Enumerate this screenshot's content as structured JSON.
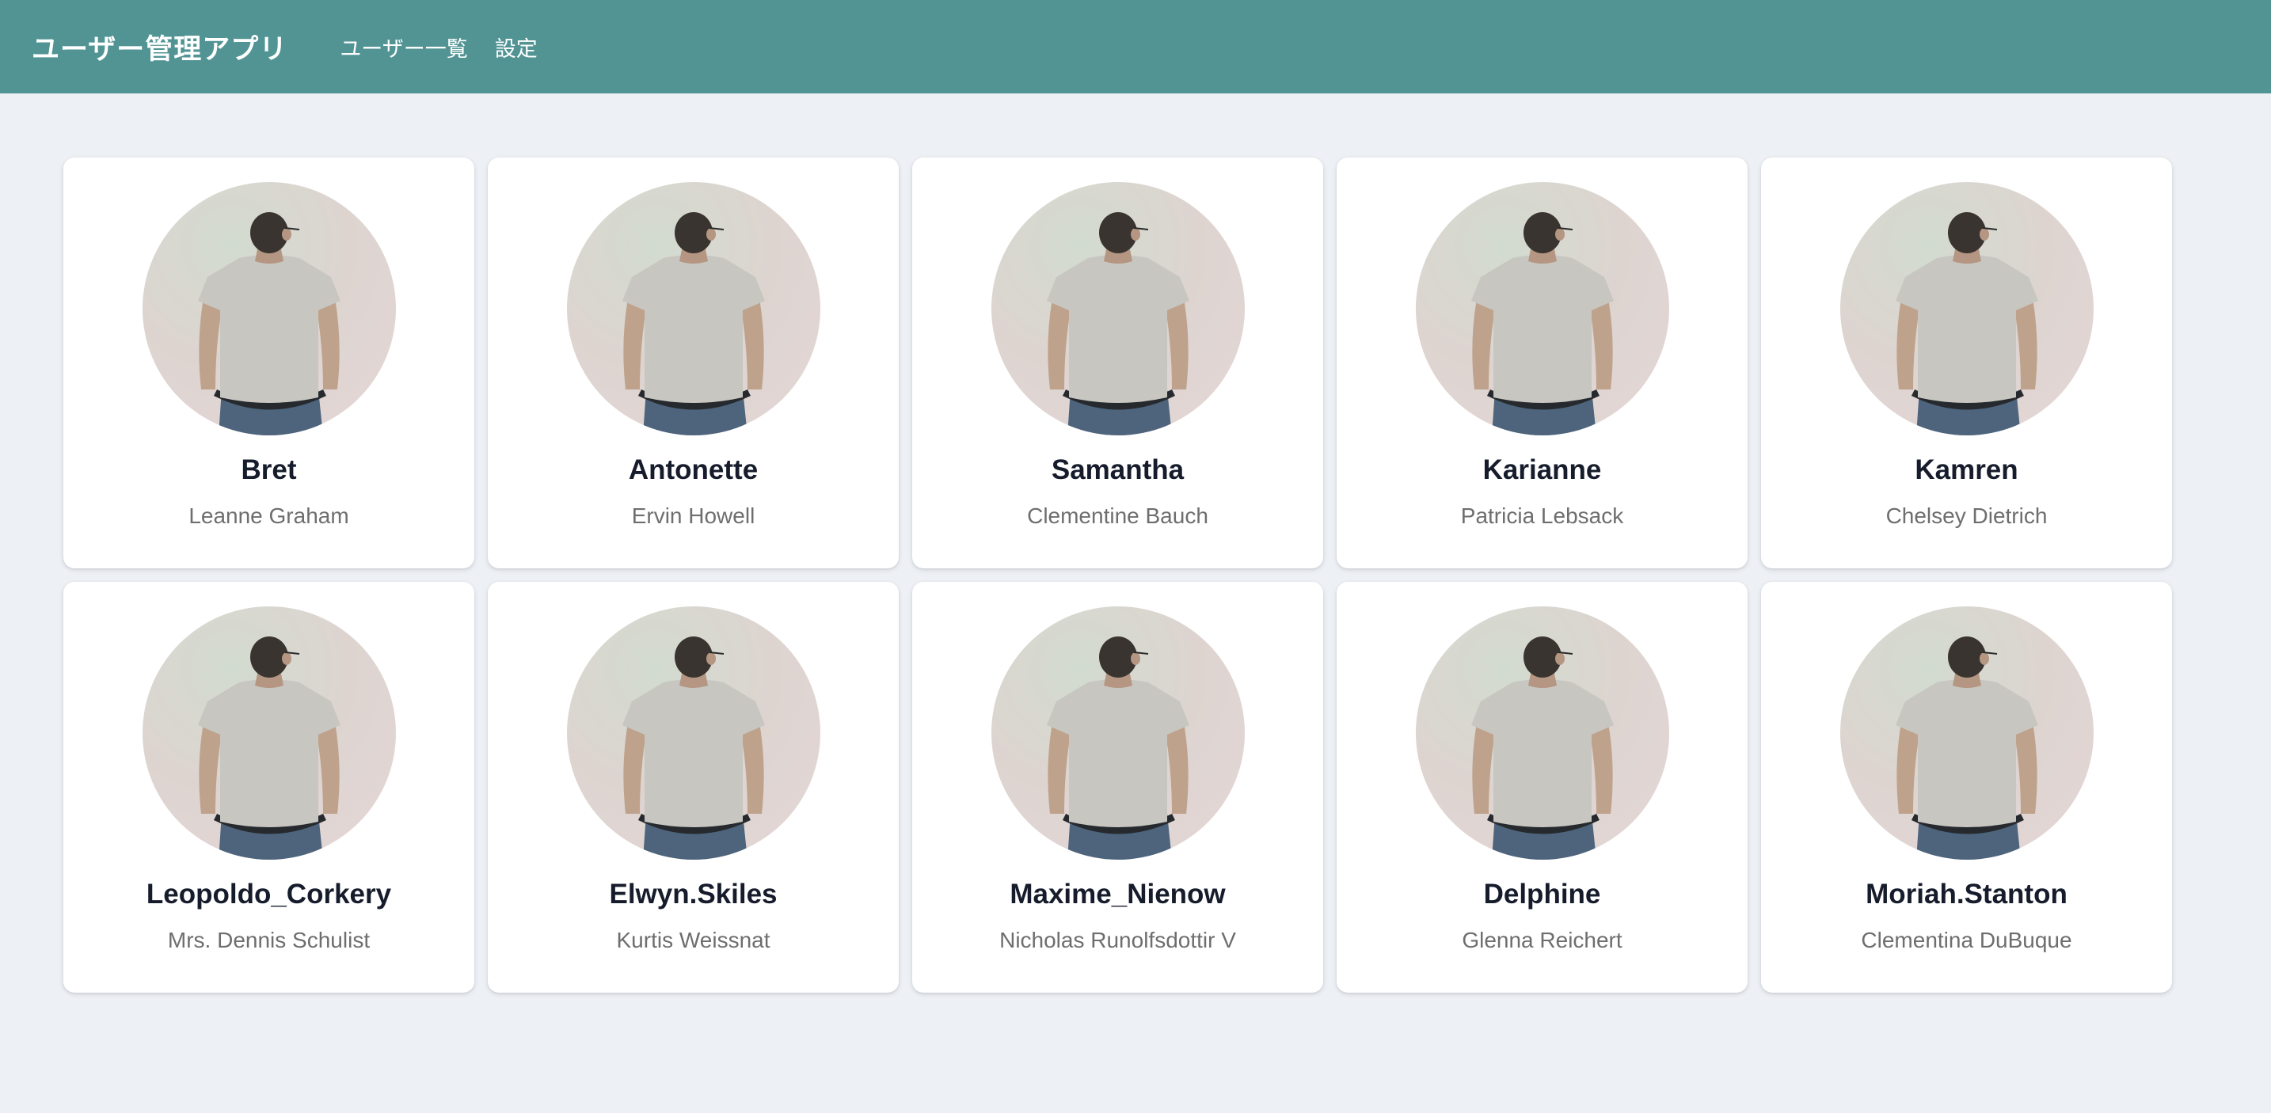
{
  "header": {
    "app_title": "ユーザー管理アプリ",
    "nav": [
      {
        "label": "ユーザー一覧"
      },
      {
        "label": "設定"
      }
    ],
    "background_color": "#529494"
  },
  "users": [
    {
      "username": "Bret",
      "name": "Leanne Graham",
      "avatar": "person-photo"
    },
    {
      "username": "Antonette",
      "name": "Ervin Howell",
      "avatar": "person-photo"
    },
    {
      "username": "Samantha",
      "name": "Clementine Bauch",
      "avatar": "person-photo"
    },
    {
      "username": "Karianne",
      "name": "Patricia Lebsack",
      "avatar": "person-photo"
    },
    {
      "username": "Kamren",
      "name": "Chelsey Dietrich",
      "avatar": "person-photo"
    },
    {
      "username": "Leopoldo_Corkery",
      "name": "Mrs. Dennis Schulist",
      "avatar": "person-photo"
    },
    {
      "username": "Elwyn.Skiles",
      "name": "Kurtis Weissnat",
      "avatar": "person-photo"
    },
    {
      "username": "Maxime_Nienow",
      "name": "Nicholas Runolfsdottir V",
      "avatar": "person-photo"
    },
    {
      "username": "Delphine",
      "name": "Glenna Reichert",
      "avatar": "person-photo"
    },
    {
      "username": "Moriah.Stanton",
      "name": "Clementina DuBuque",
      "avatar": "person-photo"
    }
  ]
}
